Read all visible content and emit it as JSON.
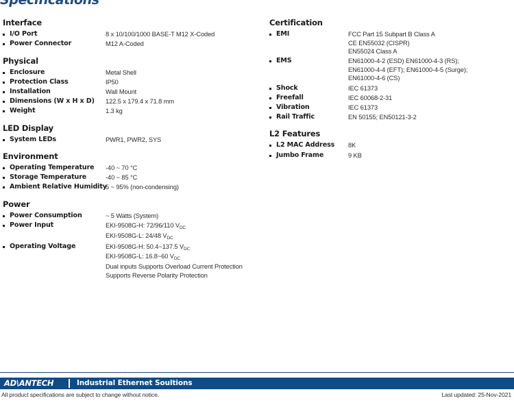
{
  "page": {
    "title": "Specifications"
  },
  "left_column": [
    {
      "title": "Interface",
      "rows": [
        {
          "label": "I/O Port",
          "value": [
            "8 x 10/100/1000 BASE-T M12 X-Coded"
          ]
        },
        {
          "label": "Power Connector",
          "value": [
            "M12 A-Coded"
          ]
        }
      ]
    },
    {
      "title": "Physical",
      "rows": [
        {
          "label": "Enclosure",
          "value": [
            "Metal Shell"
          ]
        },
        {
          "label": "Protection Class",
          "value": [
            "IP50"
          ]
        },
        {
          "label": "Installation",
          "value": [
            "Wall Mount"
          ]
        },
        {
          "label": "Dimensions (W x H x D)",
          "value": [
            "122.5 x 179.4 x 71.8 mm"
          ]
        },
        {
          "label": "Weight",
          "value": [
            "1.3 kg"
          ]
        }
      ]
    },
    {
      "title": "LED Display",
      "rows": [
        {
          "label": "System LEDs",
          "value": [
            "PWR1, PWR2, SYS"
          ]
        }
      ]
    },
    {
      "title": "Environment",
      "rows": [
        {
          "label": "Operating Temperature",
          "value": [
            "-40 ~ 70 °C"
          ]
        },
        {
          "label": "Storage Temperature",
          "value": [
            "-40 ~ 85 °C"
          ]
        },
        {
          "label": "Ambient Relative Humidity",
          "wide": true,
          "value": [
            "5 ~ 95% (non-condensing)"
          ]
        }
      ]
    },
    {
      "title": "Power",
      "rows": [
        {
          "label": "Power Consumption",
          "value": [
            "~ 5 Watts (System)"
          ]
        },
        {
          "label": "Power Input",
          "value": [
            "EKI-9508G-H: 72/96/110 V[DC]",
            "EKI-9508G-L: 24/48 V[DC]"
          ]
        },
        {
          "label": "Operating Voltage",
          "value": [
            "EKI-9508G-H: 50.4~137.5 V[DC]",
            "EKI-9508G-L: 16.8~60 V[DC]",
            "Dual inputs Supports Overload Current Protection",
            "Supports Reverse Polarity Protection"
          ]
        }
      ]
    }
  ],
  "right_column": [
    {
      "title": "Certification",
      "rows": [
        {
          "label": "EMI",
          "value": [
            "FCC Part 15 Subpart B Class A",
            "CE EN55032 (CISPR)",
            "EN55024 Class A"
          ]
        },
        {
          "label": "EMS",
          "value": [
            "EN61000-4-2 (ESD) EN61000-4-3 (RS);",
            "EN61000-4-4 (EFT); EN61000-4-5 (Surge);",
            "EN61000-4-6 (CS)"
          ]
        },
        {
          "label": "Shock",
          "value": [
            "IEC 61373"
          ]
        },
        {
          "label": "Freefall",
          "value": [
            "IEC 60068-2-31"
          ]
        },
        {
          "label": "Vibration",
          "value": [
            "IEC 61373"
          ]
        },
        {
          "label": "Rail Traffic",
          "value": [
            "EN 50155; EN50121-3-2"
          ]
        }
      ]
    },
    {
      "title": "L2 Features",
      "rows": [
        {
          "label": "L2 MAC Address",
          "value": [
            "8K"
          ]
        },
        {
          "label": "Jumbo Frame",
          "value": [
            "9 KB"
          ]
        }
      ]
    }
  ],
  "footer": {
    "logo": "AD\\ANTECH",
    "tagline": "Industrial Ethernet Soultions",
    "disclaimer": "All product specifications are subject to change without notice.",
    "last_updated": "Last updated: 25-Nov-2021"
  },
  "colors": {
    "brand_blue": "#0f4c87",
    "title_blue": "#1f4b80",
    "label_black": "#1a1a1a",
    "value_gray": "#2b2b2b"
  }
}
